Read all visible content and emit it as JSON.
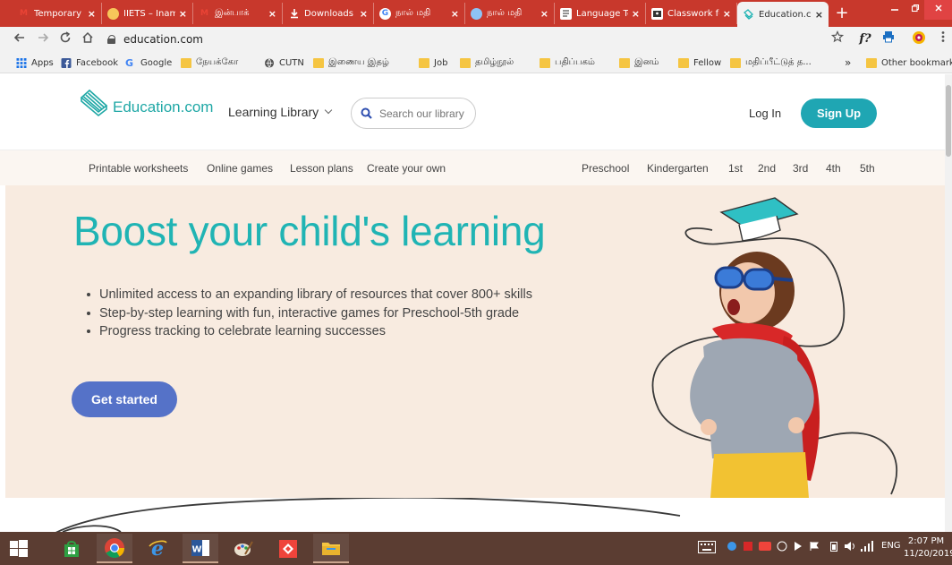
{
  "browser": {
    "tabs": [
      {
        "title": "Temporary I",
        "icon": "gmail-icon",
        "active": false
      },
      {
        "title": "IIETS – Inam",
        "icon": "iiets-icon",
        "active": false
      },
      {
        "title": "இன்பாக்",
        "icon": "gmail-icon",
        "active": false
      },
      {
        "title": "Downloads",
        "icon": "download-icon",
        "active": false
      },
      {
        "title": "நால் மதி",
        "icon": "google-icon",
        "active": false
      },
      {
        "title": "நால் மதி",
        "icon": "globe-icon",
        "active": false
      },
      {
        "title": "Language Te",
        "icon": "document-icon",
        "active": false
      },
      {
        "title": "Classwork fo",
        "icon": "classroom-icon",
        "active": false
      },
      {
        "title": "Education.c",
        "icon": "education-icon",
        "active": true
      }
    ],
    "new_tab": "+",
    "close_glyph": "×",
    "url": "education.com",
    "toolbar_ext_label": "f?",
    "bookmarks": [
      {
        "label": "Apps",
        "icon": "apps-grid-icon"
      },
      {
        "label": "Facebook",
        "icon": "facebook-icon"
      },
      {
        "label": "Google",
        "icon": "google-icon"
      },
      {
        "label": "நேயக்கோ",
        "icon": "folder-icon"
      },
      {
        "label": "CUTN",
        "icon": "globe-icon"
      },
      {
        "label": "இணைய இதழ்",
        "icon": "folder-icon"
      },
      {
        "label": "Job",
        "icon": "folder-icon"
      },
      {
        "label": "தமிழ்நூல்",
        "icon": "folder-icon"
      },
      {
        "label": "பதிப்பகம்",
        "icon": "folder-icon"
      },
      {
        "label": "இனம்",
        "icon": "folder-icon"
      },
      {
        "label": "Fellow",
        "icon": "folder-icon"
      },
      {
        "label": "மதிப்பீட்டுத் த...",
        "icon": "folder-icon"
      }
    ],
    "more_bookmarks": "»",
    "other_bookmarks": "Other bookmarks"
  },
  "site": {
    "logo_text": "Education.com",
    "learning_library": "Learning Library",
    "search_placeholder": "Search our library",
    "login": "Log In",
    "signup": "Sign Up",
    "subnav_left": [
      "Printable worksheets",
      "Online games",
      "Lesson plans",
      "Create your own"
    ],
    "subnav_right": [
      "Preschool",
      "Kindergarten",
      "1st",
      "2nd",
      "3rd",
      "4th",
      "5th"
    ],
    "hero": {
      "title": "Boost your child's learning",
      "bullets": [
        "Unlimited access to an expanding library of resources that cover 800+ skills",
        "Step-by-step learning with fun, interactive games for Preschool-5th grade",
        "Progress tracking to celebrate learning successes"
      ],
      "cta": "Get started"
    }
  },
  "taskbar": {
    "apps": [
      "store-icon",
      "chrome-icon",
      "internet-explorer-icon",
      "word-icon",
      "paint-icon",
      "anydesk-icon",
      "file-explorer-icon"
    ],
    "tray_lang": "ENG",
    "time": "2:07 PM",
    "date": "11/20/2019"
  },
  "colors": {
    "chrome_frame": "#c8382c",
    "brand_teal": "#20b4b4",
    "signup_bg": "#1fa6b3",
    "cta_bg": "#5572c8",
    "hero_bg": "#f8ebe0",
    "taskbar_bg": "#5b3d32"
  }
}
